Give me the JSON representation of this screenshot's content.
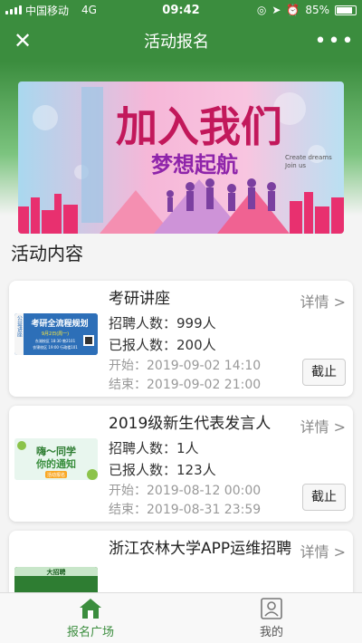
{
  "status_bar": {
    "carrier": "中国移动",
    "network": "4G",
    "time": "09:42",
    "battery": "85%",
    "battery_level": 0.85
  },
  "nav": {
    "title": "活动报名"
  },
  "banner": {
    "title_text": "加入我们",
    "subtitle_text": "梦想起航",
    "tagline_1": "Create dreams",
    "tagline_2": "Join us"
  },
  "section": {
    "title": "活动内容"
  },
  "cards": [
    {
      "title": "考研讲座",
      "recruit_label": "招聘人数：",
      "recruit_value": "999人",
      "signed_label": "已报人数：",
      "signed_value": "200人",
      "start_label": "开始：",
      "start_value": "2019-09-02 14:10",
      "end_label": "结束：",
      "end_value": "2019-09-02 21:00",
      "detail": "详情 >",
      "status": "截止",
      "thumb": {
        "heading": "考研全流程规划",
        "side": "公益讲座",
        "line1": "9月2日(周一)",
        "line2": "东湖校区 18:30 教2101",
        "line3": "衣锦校区 19:00 行政楼101"
      }
    },
    {
      "title": "2019级新生代表发言人",
      "recruit_label": "招聘人数：",
      "recruit_value": "1人",
      "signed_label": "已报人数：",
      "signed_value": "123人",
      "start_label": "开始：",
      "start_value": "2019-08-12 00:00",
      "end_label": "结束：",
      "end_value": "2019-08-31 23:59",
      "detail": "详情 >",
      "status": "截止",
      "thumb": {
        "heading": "嗨～同学",
        "sub": "你的通知",
        "badge": "活动报名"
      }
    },
    {
      "title": "浙江农林大学APP运维招聘",
      "detail": "详情 >",
      "thumb": {
        "heading": "大招聘"
      }
    }
  ],
  "tabs": [
    {
      "label": "报名广场",
      "icon": "home-icon",
      "active": true
    },
    {
      "label": "我的",
      "icon": "profile-card-icon",
      "active": false
    }
  ],
  "colors": {
    "primary": "#3b8d3e",
    "banner_pink": "#f6b7d8",
    "banner_blue": "#bfe2f3"
  }
}
